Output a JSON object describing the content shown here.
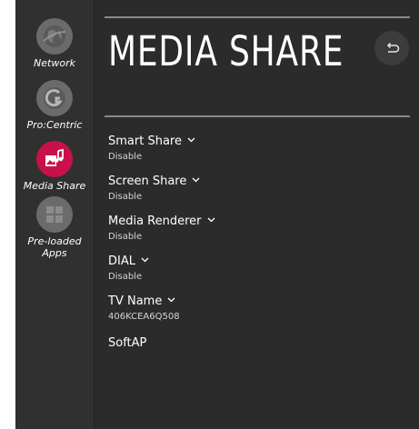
{
  "sidebar": {
    "items": [
      {
        "label": "Network",
        "icon": "globe-icon",
        "active": false
      },
      {
        "label": "Pro:Centric",
        "icon": "procentric-icon",
        "active": false
      },
      {
        "label": "Media Share",
        "icon": "media-share-icon",
        "active": true
      },
      {
        "label": "Pre-loaded Apps",
        "icon": "apps-grid-icon",
        "active": false
      }
    ]
  },
  "header": {
    "title": "MEDIA SHARE",
    "back_icon": "back-icon"
  },
  "settings": [
    {
      "name": "Smart Share",
      "value": "Disable",
      "expandable": true
    },
    {
      "name": "Screen Share",
      "value": "Disable",
      "expandable": true
    },
    {
      "name": "Media Renderer",
      "value": "Disable",
      "expandable": true
    },
    {
      "name": "DIAL",
      "value": "Disable",
      "expandable": true
    },
    {
      "name": "TV Name",
      "value": "406KCEA6Q508",
      "expandable": true
    },
    {
      "name": "SoftAP",
      "value": "",
      "expandable": false
    }
  ],
  "colors": {
    "accent": "#c8114a",
    "background": "#2b2b2b",
    "sidebar": "#303030"
  }
}
